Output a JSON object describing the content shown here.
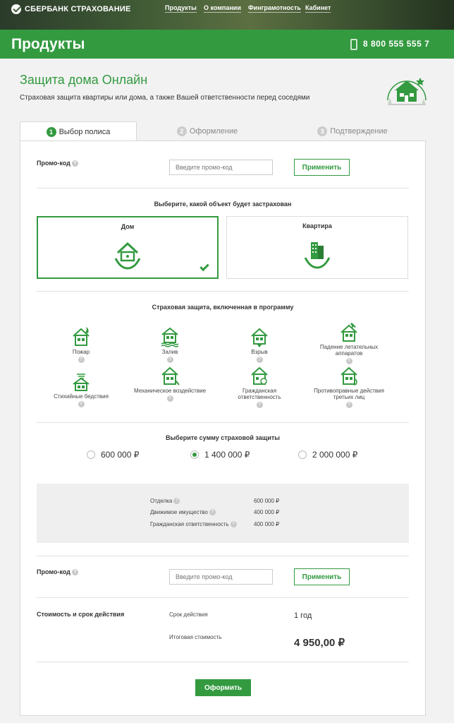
{
  "brand": {
    "name": "СБЕРБАНК СТРАХОВАНИЕ"
  },
  "nav": {
    "items": [
      "Продукты",
      "О компании",
      "Финграмотность",
      "Кабинет"
    ]
  },
  "header": {
    "title": "Продукты",
    "phone": "8 800 555 555 7"
  },
  "product": {
    "title": "Защита дома Онлайн",
    "subtitle": "Страховая защита квартиры или дома, а также Вашей ответственности перед соседями"
  },
  "tabs": [
    {
      "num": "1",
      "label": "Выбор полиса"
    },
    {
      "num": "2",
      "label": "Оформление"
    },
    {
      "num": "3",
      "label": "Подтверждение"
    }
  ],
  "promo": {
    "label": "Промо-код",
    "placeholder": "Введите промо-код",
    "button": "Применить"
  },
  "object": {
    "title": "Выберите, какой объект будет застрахован",
    "options": [
      "Дом",
      "Квартира"
    ],
    "selected": 0
  },
  "coverage": {
    "title": "Страховая защита, включенная в программу",
    "risks": [
      {
        "icon": "fire-house-icon",
        "label": "Пожар"
      },
      {
        "icon": "flood-house-icon",
        "label": "Залив"
      },
      {
        "icon": "explosion-house-icon",
        "label": "Взрыв"
      },
      {
        "icon": "aircraft-house-icon",
        "label": "Падение летательных аппаратов"
      },
      {
        "icon": "storm-house-icon",
        "label": "Стихийные бедствия"
      },
      {
        "icon": "mechanical-house-icon",
        "label": "Механическое воздействие"
      },
      {
        "icon": "liability-house-icon",
        "label": "Гражданская ответственность"
      },
      {
        "icon": "illegal-house-icon",
        "label": "Противоправные действия третьих лиц"
      }
    ]
  },
  "sum": {
    "title": "Выберите сумму страховой защиты",
    "options": [
      "600 000 ₽",
      "1 400 000 ₽",
      "2 000 000 ₽"
    ],
    "selected": 1
  },
  "breakdown": [
    {
      "label": "Отделка",
      "value": "600 000 ₽"
    },
    {
      "label": "Движимое имущество",
      "value": "400 000 ₽"
    },
    {
      "label": "Гражданская ответственность",
      "value": "400 000 ₽"
    }
  ],
  "cost": {
    "label": "Стоимость и срок действия",
    "term_label": "Срок действия",
    "term_value": "1 год",
    "total_label": "Итоговая стоимость",
    "total_value": "4 950,00 ₽"
  },
  "submit": {
    "label": "Оформить"
  },
  "colors": {
    "accent": "#339a40",
    "text": "#333333",
    "muted": "#888888"
  }
}
